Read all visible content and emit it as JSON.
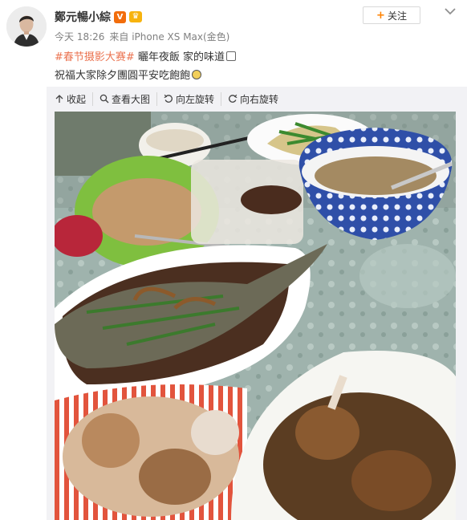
{
  "user": {
    "name": "鄭元暢小綜",
    "vip_badge": "V",
    "crown_badge": "♛"
  },
  "meta": {
    "time": "今天 18:26",
    "source": "来自 iPhone XS Max(金色)"
  },
  "follow": {
    "label": "关注"
  },
  "post": {
    "hashtag": "#春节摄影大赛#",
    "line1": " 曬年夜飯 家的味道",
    "line2": "祝福大家除夕團圓平安吃飽飽"
  },
  "toolbar": {
    "collapse": "收起",
    "view_large": "查看大图",
    "rotate_left": "向左旋转",
    "rotate_right": "向右旋转"
  },
  "icons": {
    "collapse": "arrow-up-icon",
    "view_large": "magnifier-icon",
    "rotate_left": "rotate-left-icon",
    "rotate_right": "rotate-right-icon",
    "menu": "chevron-down-icon"
  },
  "colors": {
    "hashtag": "#eb7350",
    "follow_plus": "#ff8200",
    "meta_text": "#808080"
  }
}
